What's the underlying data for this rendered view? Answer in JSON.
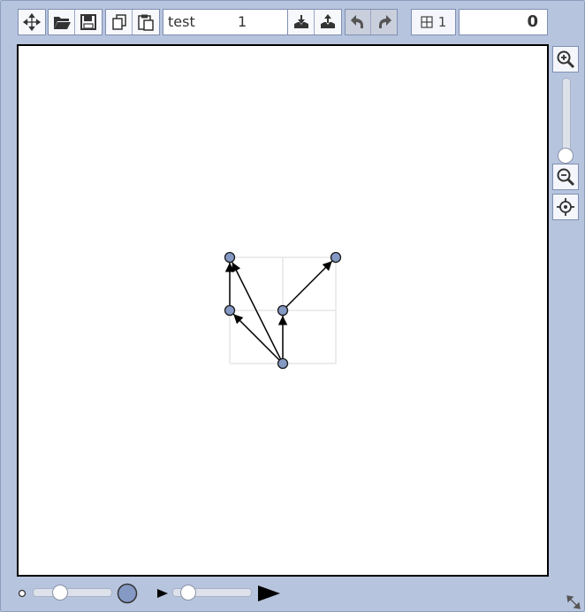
{
  "toolbar": {
    "graph_name": "test",
    "graph_index": "1",
    "grid_label": "1",
    "score": "0",
    "buttons": [
      "move",
      "open",
      "save",
      "copy",
      "paste",
      "download",
      "upload",
      "undo",
      "redo"
    ]
  },
  "icons": {
    "move": "move-icon",
    "open": "folder-open-icon",
    "save": "floppy-disk-icon",
    "copy": "copy-icon",
    "paste": "paste-icon",
    "download": "tray-download-icon",
    "upload": "tray-upload-icon",
    "undo": "undo-icon",
    "redo": "redo-icon",
    "grid": "grid-icon",
    "zoom_in": "zoom-in-icon",
    "zoom_out": "zoom-out-icon",
    "center": "target-icon",
    "resize": "resize-icon"
  },
  "graph": {
    "grid_size": 2,
    "nodes": [
      {
        "id": "a",
        "col": 0,
        "row": 0
      },
      {
        "id": "b",
        "col": 2,
        "row": 0
      },
      {
        "id": "c",
        "col": 0,
        "row": 1
      },
      {
        "id": "d",
        "col": 1,
        "row": 1
      },
      {
        "id": "e",
        "col": 1,
        "row": 2
      }
    ],
    "edges": [
      {
        "from": "c",
        "to": "a"
      },
      {
        "from": "e",
        "to": "a"
      },
      {
        "from": "d",
        "to": "b"
      },
      {
        "from": "e",
        "to": "c"
      },
      {
        "from": "e",
        "to": "d"
      }
    ]
  },
  "sliders": {
    "zoom_level": 0.0,
    "node_size": 0.35,
    "arrow_size": 0.2
  },
  "colors": {
    "node_fill": "#8499c4",
    "node_stroke": "#1a1a1a",
    "edge": "#000000",
    "grid": "#e6e6e6"
  }
}
